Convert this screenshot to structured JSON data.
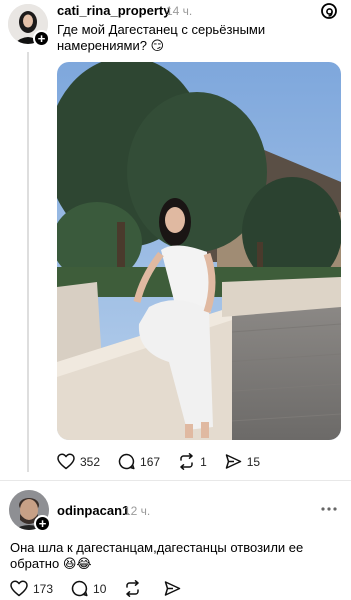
{
  "post1": {
    "username": "cati_rina_property",
    "time": "14 ч.",
    "text": "Где мой Дагестанец с серьёзными намерениями? 😏",
    "likes": "352",
    "comments": "167",
    "reposts": "1",
    "shares": "15"
  },
  "post2": {
    "username": "odinpacan1",
    "time": "12 ч.",
    "text": "Она шла к дагестанцам,дагестанцы отвозили ее обратно 😆😂",
    "likes": "173",
    "comments": "10"
  },
  "colors": {
    "sky": "#8fb6e3",
    "tree": "#2f4a33",
    "wall": "#e6ddd1",
    "dress": "#f2f2f2"
  }
}
